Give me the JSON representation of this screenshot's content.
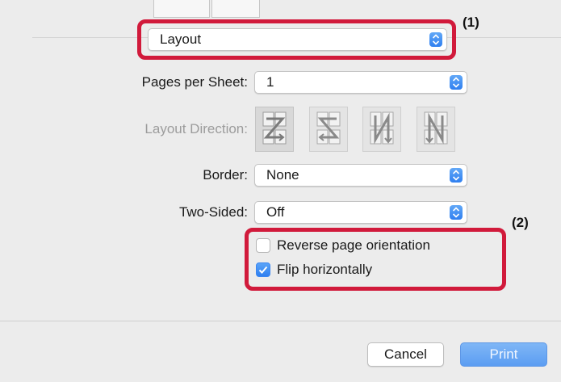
{
  "dialog": {
    "section_select": {
      "value": "Layout"
    },
    "pages_per_sheet": {
      "label": "Pages per Sheet:",
      "value": "1"
    },
    "layout_direction": {
      "label": "Layout Direction:",
      "enabled": false,
      "options": [
        "z-order-icon",
        "reverse-z-order-icon",
        "vertical-n-order-icon",
        "reverse-n-order-icon"
      ]
    },
    "border": {
      "label": "Border:",
      "value": "None"
    },
    "two_sided": {
      "label": "Two-Sided:",
      "value": "Off"
    },
    "reverse_orientation": {
      "label": "Reverse page orientation",
      "checked": false
    },
    "flip_horizontally": {
      "label": "Flip horizontally",
      "checked": true
    },
    "cancel_label": "Cancel",
    "print_label": "Print"
  },
  "annotations": {
    "callout_1": "(1)",
    "callout_2": "(2)",
    "color": "#d11a3b"
  },
  "colors": {
    "accent": "#2f7ff0",
    "background": "#ececec"
  }
}
